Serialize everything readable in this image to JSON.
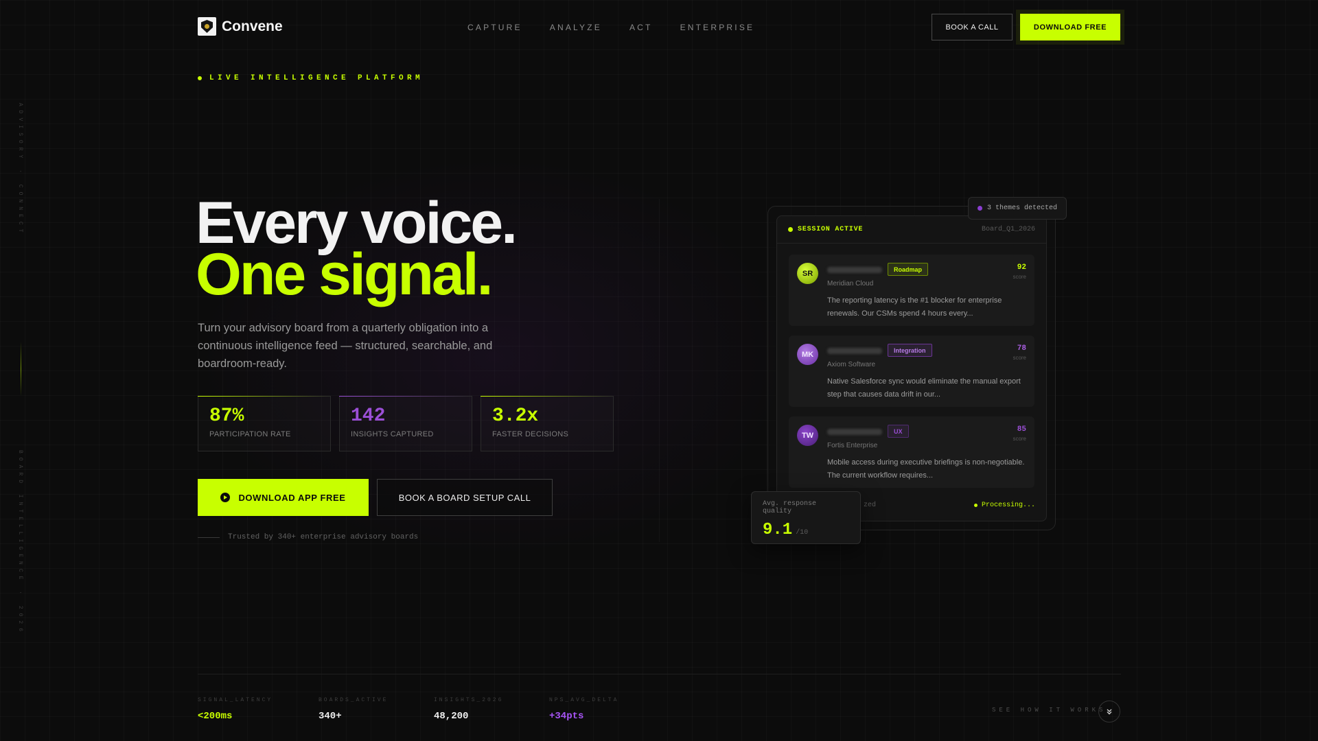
{
  "rail": {
    "top_text": "ADVISORY · CONNECT",
    "bottom_text": "BOARD INTELLIGENCE · 2026"
  },
  "brand": {
    "name": "Convene",
    "icon": "shield-logo-icon"
  },
  "nav": [
    "CAPTURE",
    "ANALYZE",
    "ACT",
    "ENTERPRISE"
  ],
  "header": {
    "book_call": "BOOK A CALL",
    "download": "DOWNLOAD FREE"
  },
  "eyebrow": "LIVE INTELLIGENCE PLATFORM",
  "hero": {
    "line1": "Every voice.",
    "line2": "One signal.",
    "subtitle": "Turn your advisory board from a quarterly obligation into a continuous intelligence feed — structured, searchable, and boardroom-ready."
  },
  "stats": [
    {
      "value": "87%",
      "label": "PARTICIPATION RATE",
      "color": "#c8ff00"
    },
    {
      "value": "142",
      "label": "INSIGHTS CAPTURED",
      "color": "#9b4fd6"
    },
    {
      "value": "3.2x",
      "label": "FASTER DECISIONS",
      "color": "#c8ff00"
    }
  ],
  "cta": {
    "primary": "DOWNLOAD APP FREE",
    "primary_icon": "play-circle-icon",
    "secondary": "BOOK A BOARD SETUP CALL"
  },
  "trusted": "Trusted by 340+ enterprise advisory boards",
  "panel": {
    "status": "SESSION ACTIVE",
    "board": "Board_Q1_2026",
    "themes": "3 themes detected",
    "entries": [
      {
        "initials": "SR",
        "tag": "Roadmap",
        "company": "Meridian Cloud",
        "score": "92",
        "score_label": "score",
        "quote": "The reporting latency is the #1 blocker for enterprise renewals. Our CSMs spend 4 hours every..."
      },
      {
        "initials": "MK",
        "tag": "Integration",
        "company": "Axiom Software",
        "score": "78",
        "score_label": "score",
        "quote": "Native Salesforce sync would eliminate the manual export step that causes data drift in our..."
      },
      {
        "initials": "TW",
        "tag": "UX",
        "company": "Fortis Enterprise",
        "score": "85",
        "score_label": "score",
        "quote": "Mobile access during executive briefings is non-negotiable. The current workflow requires..."
      }
    ],
    "footer_left": "zed",
    "footer_right": "Processing..."
  },
  "quality": {
    "label": "Avg. response quality",
    "value": "9.1",
    "of": "/10"
  },
  "metrics": [
    {
      "key": "SIGNAL_LATENCY",
      "value": "<200ms",
      "color": "#c8ff00"
    },
    {
      "key": "BOARDS_ACTIVE",
      "value": "340+",
      "color": "#f0f0f0"
    },
    {
      "key": "INSIGHTS_2026",
      "value": "48,200",
      "color": "#f0f0f0"
    },
    {
      "key": "NPS_AVG_DELTA",
      "value": "+34pts",
      "color": "#a855f7"
    }
  ],
  "see_how": "SEE HOW IT WORKS",
  "see_icon": "chevron-double-down-icon"
}
